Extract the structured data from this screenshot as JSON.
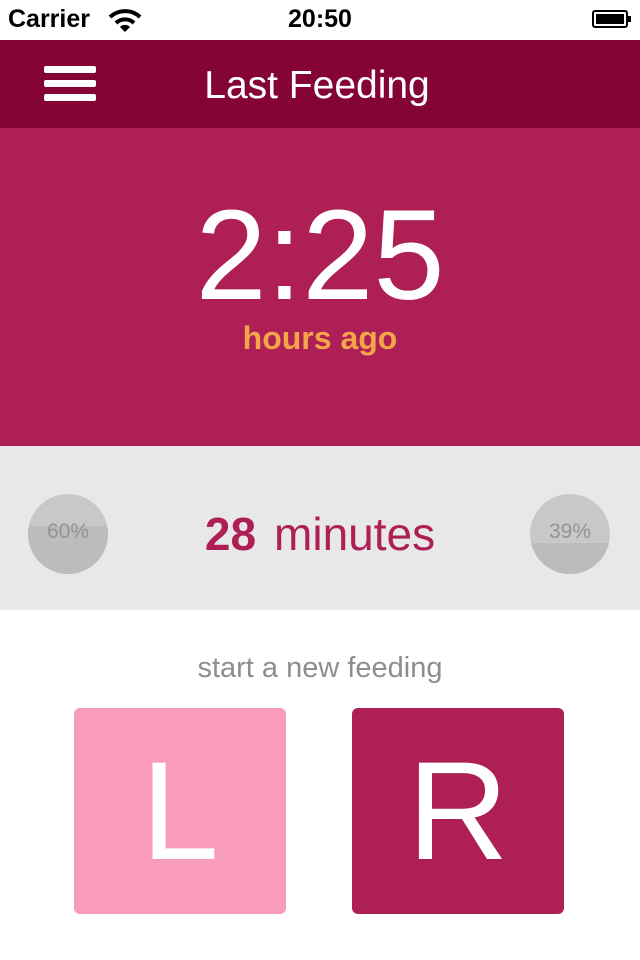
{
  "status_bar": {
    "carrier": "Carrier",
    "time": "20:50"
  },
  "nav": {
    "title": "Last Feeding",
    "menu_icon": "hamburger-menu-icon"
  },
  "last_feeding": {
    "elapsed": "2:25",
    "unit_label": "hours ago"
  },
  "session": {
    "left_percent": "60%",
    "left_fraction": 0.6,
    "right_percent": "39%",
    "right_fraction": 0.39,
    "duration_value": "28",
    "duration_unit": "minutes"
  },
  "new_feeding": {
    "label": "start a new feeding",
    "left_button": "L",
    "right_button": "R"
  },
  "colors": {
    "nav": "#840436",
    "accent": "#ae1f55",
    "highlight": "#f4a449",
    "left_button": "#f99bbb"
  }
}
